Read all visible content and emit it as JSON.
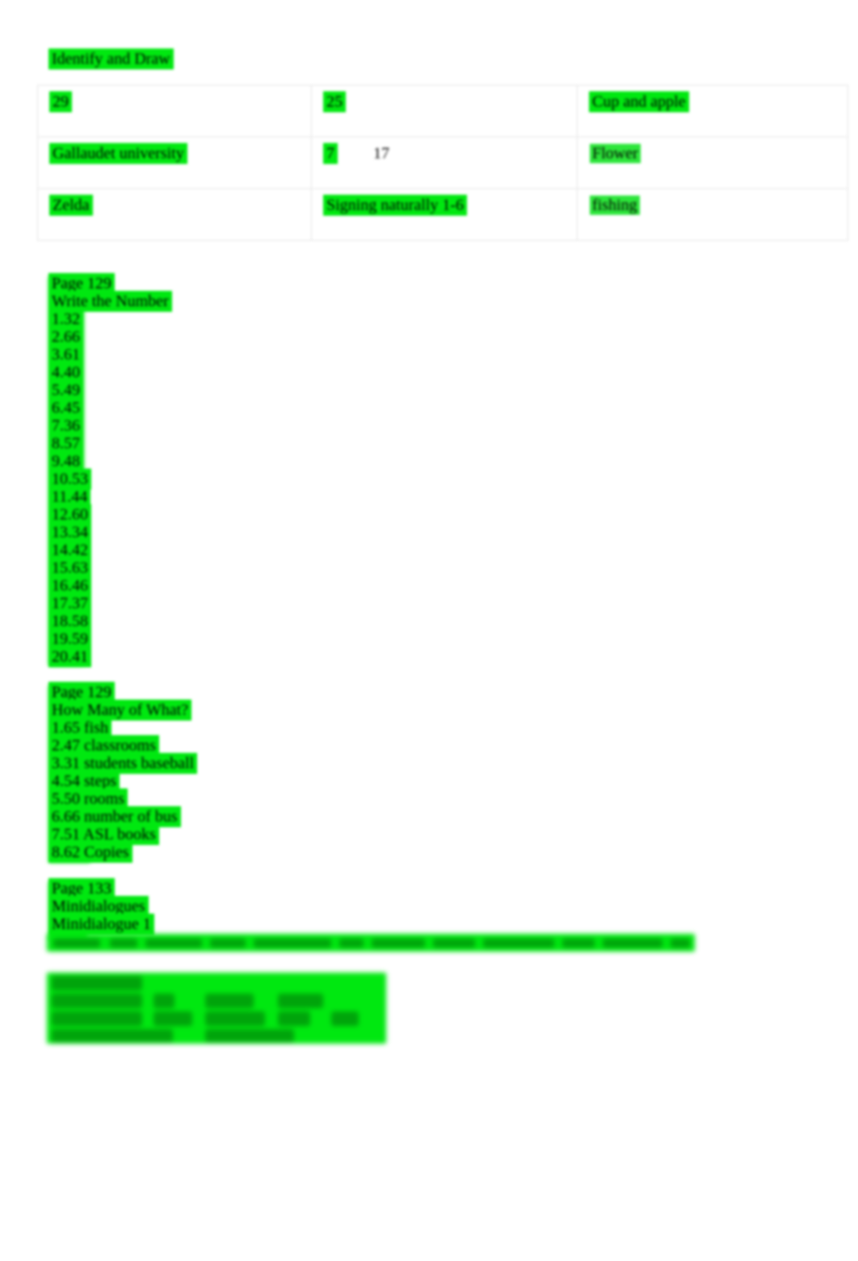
{
  "document": {
    "title": "Identify and Draw",
    "highlight_color": "#00e810",
    "page_background": "#ffffff"
  },
  "table": {
    "columns": 3,
    "rows": [
      {
        "cells": [
          {
            "text": "29",
            "highlighted": true
          },
          {
            "text": "25",
            "highlighted": true
          },
          {
            "text": "Cup and apple",
            "highlighted": true
          }
        ]
      },
      {
        "cells": [
          {
            "text": "Gallaudet university",
            "highlighted": true
          },
          {
            "text": "7",
            "text_secondary": "17",
            "highlighted": true
          },
          {
            "text": "Flower",
            "highlighted": true
          }
        ]
      },
      {
        "cells": [
          {
            "text": "Zelda",
            "highlighted": true
          },
          {
            "text": "Signing naturally 1-6",
            "highlighted": true
          },
          {
            "text": "fishing",
            "highlighted": true
          }
        ]
      }
    ]
  },
  "write_the_number": {
    "page_label": "Page 129",
    "heading": "Write the Number",
    "items": [
      "1.32",
      "2.66",
      "3.61",
      "4.40",
      "5.49",
      "6.45",
      "7.36",
      "8.57",
      "9.48",
      "10.53",
      "11.44",
      "12.60",
      "13.34",
      "14.42",
      "15.63",
      "16.46",
      "17.37",
      "18.58",
      "19.59",
      "20.41"
    ]
  },
  "how_many_of_what": {
    "page_label": "Page 129",
    "heading": "How Many of What?",
    "items": [
      "1.65 fish",
      "2.47 classrooms",
      "3.31 students baseball",
      "4.54 steps",
      "5.50 rooms",
      "6.66 number of bus",
      "7.51 ASL books",
      "8.62 Copies"
    ]
  },
  "minidialogues": {
    "page_label": "Page 133",
    "heading": "Minidialogues",
    "subheading": "Minidialogue 1",
    "obscured_note": ""
  }
}
